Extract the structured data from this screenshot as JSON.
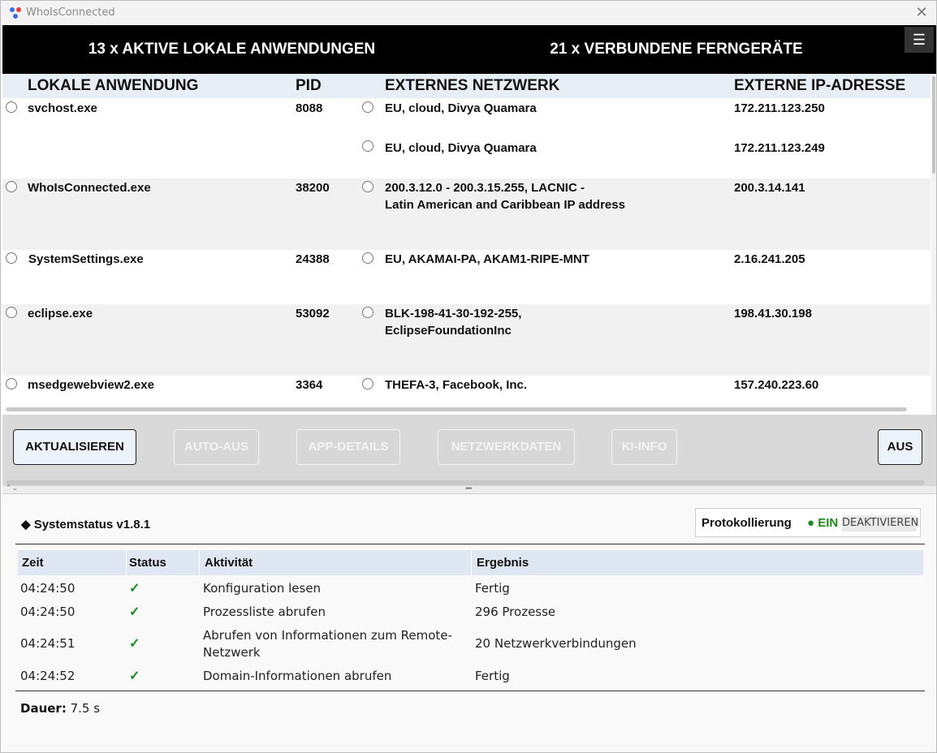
{
  "window": {
    "title": "WhoIsConnected",
    "close_label": "✕"
  },
  "header": {
    "left": "13 x AKTIVE LOKALE ANWENDUNGEN",
    "right": "21 x VERBUNDENE FERNGERÄTE",
    "menu_icon": "☰"
  },
  "columns": {
    "app": "LOKALE ANWENDUNG",
    "pid": "PID",
    "network": "EXTERNES NETZWERK",
    "ip": "EXTERNE IP-ADRESSE"
  },
  "rows": [
    {
      "app": "svchost.exe",
      "pid": "8088",
      "connections": [
        {
          "network": "EU, cloud, Divya Quamara",
          "ip": "172.211.123.250"
        },
        {
          "network": "EU, cloud, Divya Quamara",
          "ip": "172.211.123.249"
        }
      ]
    },
    {
      "app": "WhoIsConnected.exe",
      "pid": "38200",
      "connections": [
        {
          "network": "200.3.12.0 - 200.3.15.255, LACNIC -",
          "network2": "Latin American and Caribbean IP address",
          "ip": "200.3.14.141"
        }
      ]
    },
    {
      "app": "SystemSettings.exe",
      "pid": "24388",
      "connections": [
        {
          "network": "EU, AKAMAI-PA, AKAM1-RIPE-MNT",
          "ip": "2.16.241.205"
        }
      ]
    },
    {
      "app": "eclipse.exe",
      "pid": "53092",
      "connections": [
        {
          "network": "BLK-198-41-30-192-255,",
          "network2": "EclipseFoundationInc",
          "ip": "198.41.30.198"
        }
      ]
    },
    {
      "app": "msedgewebview2.exe",
      "pid": "3364",
      "connections": [
        {
          "network": "THEFA-3, Facebook, Inc.",
          "ip": "157.240.223.60"
        }
      ]
    }
  ],
  "buttons": {
    "refresh": "AKTUALISIEREN",
    "auto_off": "AUTO-AUS",
    "app_details": "APP-DETAILS",
    "network_data": "NETZWERKDATEN",
    "ai_info": "KI-INFO",
    "off": "AUS"
  },
  "status": {
    "title": "Systemstatus v1.8.1",
    "logging_label": "Protokollierung",
    "logging_state": "● EIN",
    "logging_toggle": "DEAKTIVIEREN",
    "headers": {
      "time": "Zeit",
      "status": "Status",
      "activity": "Aktivität",
      "result": "Ergebnis"
    },
    "log": [
      {
        "time": "04:24:50",
        "status": "✓",
        "activity": "Konfiguration lesen",
        "result": "Fertig"
      },
      {
        "time": "04:24:50",
        "status": "✓",
        "activity": "Prozessliste abrufen",
        "result": "296 Prozesse"
      },
      {
        "time": "04:24:51",
        "status": "✓",
        "activity": "Abrufen von Informationen zum Remote-",
        "activity2": "Netzwerk",
        "result": "20 Netzwerkverbindungen"
      },
      {
        "time": "04:24:52",
        "status": "✓",
        "activity": "Domain-Informationen abrufen",
        "result": "Fertig"
      }
    ],
    "duration_label": "Dauer:",
    "duration_value": "7.5 s"
  },
  "colors": {
    "header_bg": "#000000",
    "accent_green": "#1e8a1e",
    "table_head_bg": "#e8eef6"
  }
}
